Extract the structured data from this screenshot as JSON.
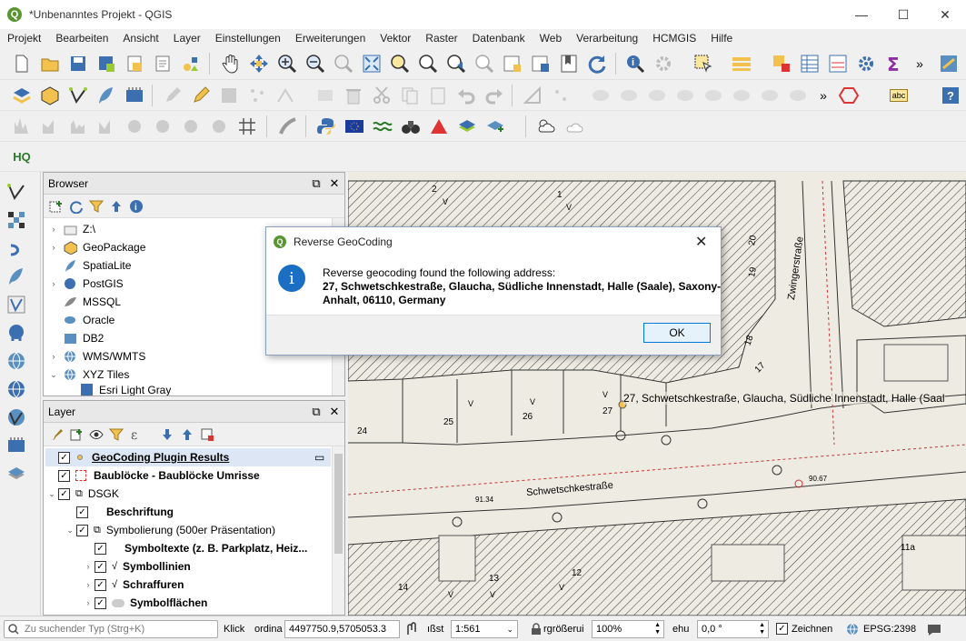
{
  "window": {
    "title": "*Unbenanntes Projekt - QGIS",
    "logo": "Q",
    "minimize": "—",
    "maximize": "☐",
    "close": "✕"
  },
  "menu": [
    "Projekt",
    "Bearbeiten",
    "Ansicht",
    "Layer",
    "Einstellungen",
    "Erweiterungen",
    "Vektor",
    "Raster",
    "Datenbank",
    "Web",
    "Verarbeitung",
    "HCMGIS",
    "Hilfe"
  ],
  "toolbar": {
    "overflow": "»",
    "hq_label": "HQ",
    "abc_label": "abc"
  },
  "browser": {
    "title": "Browser",
    "items": [
      "Z:\\",
      "GeoPackage",
      "SpatiaLite",
      "PostGIS",
      "MSSQL",
      "Oracle",
      "DB2",
      "WMS/WMTS",
      "XYZ Tiles",
      "Esri Light Gray"
    ]
  },
  "layers": {
    "title": "Layer",
    "items": [
      {
        "label": "GeoCoding Plugin Results"
      },
      {
        "label": "Baublöcke - Baublöcke Umrisse"
      },
      {
        "label": "DSGK"
      },
      {
        "label": "Beschriftung"
      },
      {
        "label": "Symbolierung (500er Präsentation)"
      },
      {
        "label": "Symboltexte (z. B. Parkplatz, Heiz..."
      },
      {
        "label": "Symbollinien"
      },
      {
        "label": "Schraffuren"
      },
      {
        "label": "Symbolflächen"
      }
    ]
  },
  "dialog": {
    "title": "Reverse GeoCoding",
    "message": "Reverse geocoding found the following address:",
    "address_line1": "27, Schwetschkestraße, Glaucha, Südliche Innenstadt, Halle (Saale), Saxony-",
    "address_line2": "Anhalt, 06110, Germany",
    "ok": "OK",
    "info_icon": "i"
  },
  "map": {
    "street1": "Schwetschkestraße",
    "street2": "Zwingerstraße",
    "result_label": "27, Schwetschkestraße, Glaucha, Südliche Innenstadt, Halle (Saal",
    "numbers": [
      "2",
      "1",
      "20",
      "19",
      "18",
      "17",
      "24",
      "25",
      "26",
      "27",
      "13",
      "12",
      "14",
      "11a",
      "V",
      "V",
      "V",
      "V",
      "V",
      "V",
      "V",
      "V"
    ],
    "elevations": [
      "91.34",
      "90.67"
    ]
  },
  "status": {
    "search_placeholder": "Zu suchender Typ (Strg+K)",
    "click_label": "Klick",
    "coord_label": "ordina",
    "coord_value": "4497750.9,5705053.3",
    "scale_label": "ıßst",
    "scale_value": "1:561",
    "magnifier_label": "rgrößerui",
    "magnifier_value": "100%",
    "rotation_label": "ehu",
    "rotation_value": "0,0 °",
    "render_label": "Zeichnen",
    "crs": "EPSG:2398"
  }
}
